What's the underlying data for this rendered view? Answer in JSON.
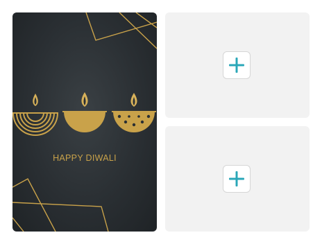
{
  "card": {
    "greeting": "HAPPY DIWALI",
    "colors": {
      "background": "#2a2f33",
      "gold": "#c9a24a"
    }
  },
  "slots": [
    {
      "icon": "plus-icon",
      "accent": "#2aa7b8"
    },
    {
      "icon": "plus-icon",
      "accent": "#2aa7b8"
    }
  ]
}
